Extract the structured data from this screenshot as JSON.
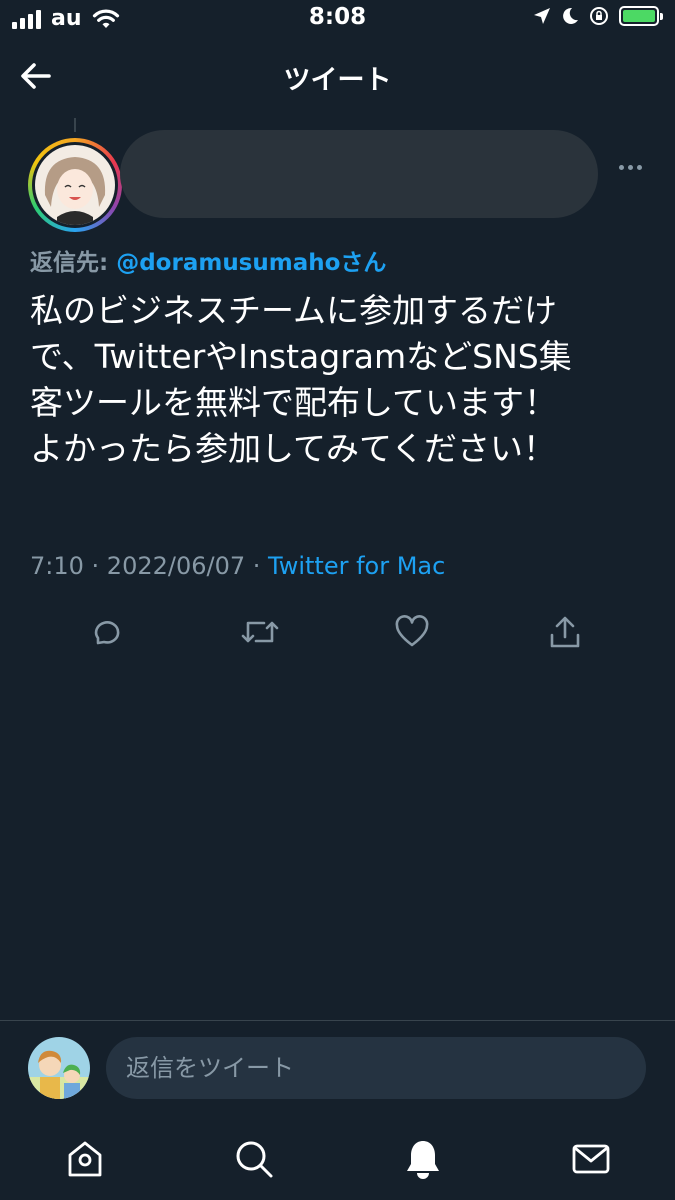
{
  "status_bar": {
    "carrier": "au",
    "time": "8:08"
  },
  "header": {
    "title": "ツイート"
  },
  "tweet": {
    "reply_to_label": "返信先:",
    "reply_to_handle": "@doramusumaho",
    "reply_to_suffix": "さん",
    "text_lines": [
      "私のビジネスチームに参加するだけ",
      "で、TwitterやInstagramなどSNS集",
      "客ツールを無料で配布しています！",
      "よかったら参加してみてください！"
    ],
    "time": "7:10",
    "date": "2022/06/07",
    "separator": " · ",
    "source": "Twitter for Mac"
  },
  "reply_bar": {
    "placeholder": "返信をツイート"
  },
  "colors": {
    "background": "#15202b",
    "accent": "#1da1f2",
    "muted": "#8899a6",
    "battery": "#4cd964"
  },
  "icons": {
    "actions": [
      "reply-icon",
      "retweet-icon",
      "like-icon",
      "share-icon"
    ],
    "tabs": [
      "home-icon",
      "search-icon",
      "notifications-icon",
      "messages-icon"
    ]
  }
}
